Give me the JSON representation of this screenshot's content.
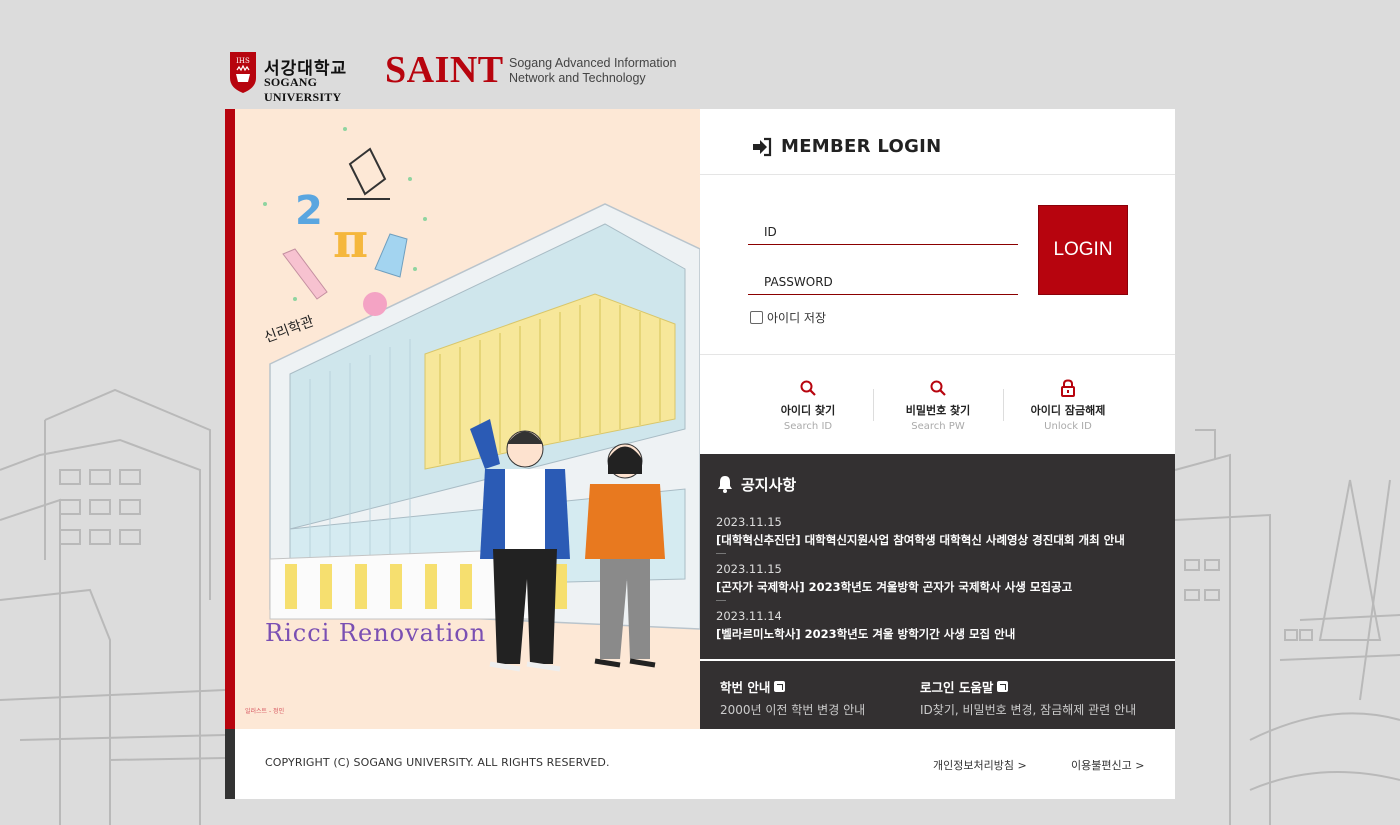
{
  "header": {
    "sogang_kor": "서강대학교",
    "sogang_eng": "SOGANG UNIVERSITY",
    "seal_text": "IHS",
    "saint": "SAINT",
    "saint_sub_line1": "Sogang Advanced Information",
    "saint_sub_line2": "Network and Technology"
  },
  "illustration": {
    "building_name": "신리학관",
    "caption": "Ricci Renovation",
    "credit": "일러스트 - 정인"
  },
  "login": {
    "title": "MEMBER LOGIN",
    "id_placeholder": "ID",
    "pw_placeholder": "PASSWORD",
    "button": "LOGIN",
    "save_id": "아이디 저장"
  },
  "quick_links": [
    {
      "ko": "아이디 찾기",
      "en": "Search ID",
      "icon": "search-icon"
    },
    {
      "ko": "비밀번호 찾기",
      "en": "Search PW",
      "icon": "search-icon"
    },
    {
      "ko": "아이디 잠금해제",
      "en": "Unlock ID",
      "icon": "lock-icon"
    }
  ],
  "notice": {
    "title": "공지사항",
    "items": [
      {
        "date": "2023.11.15",
        "text": "[대학혁신추진단] 대학혁신지원사업 참여학생 대학혁신 사례영상 경진대회 개최 안내"
      },
      {
        "date": "2023.11.15",
        "text": "[곤자가 국제학사] 2023학년도 겨울방학 곤자가 국제학사 사생 모집공고"
      },
      {
        "date": "2023.11.14",
        "text": "[벨라르미노학사] 2023학년도 겨울 방학기간 사생 모집 안내"
      }
    ]
  },
  "guides": [
    {
      "title": "학번 안내",
      "desc": "2000년 이전 학번 변경 안내"
    },
    {
      "title": "로그인 도움말",
      "desc": "ID찾기, 비밀번호 변경, 잠금해제 관련 안내"
    }
  ],
  "footer": {
    "copyright": "COPYRIGHT (C) SOGANG UNIVERSITY. ALL RIGHTS RESERVED.",
    "privacy": "개인정보처리방침 >",
    "report": "이용불편신고 >"
  },
  "colors": {
    "brand_red": "#b7040e",
    "dark": "#333031",
    "background": "#dcdcdc",
    "illustration_bg": "#fde8d6"
  }
}
